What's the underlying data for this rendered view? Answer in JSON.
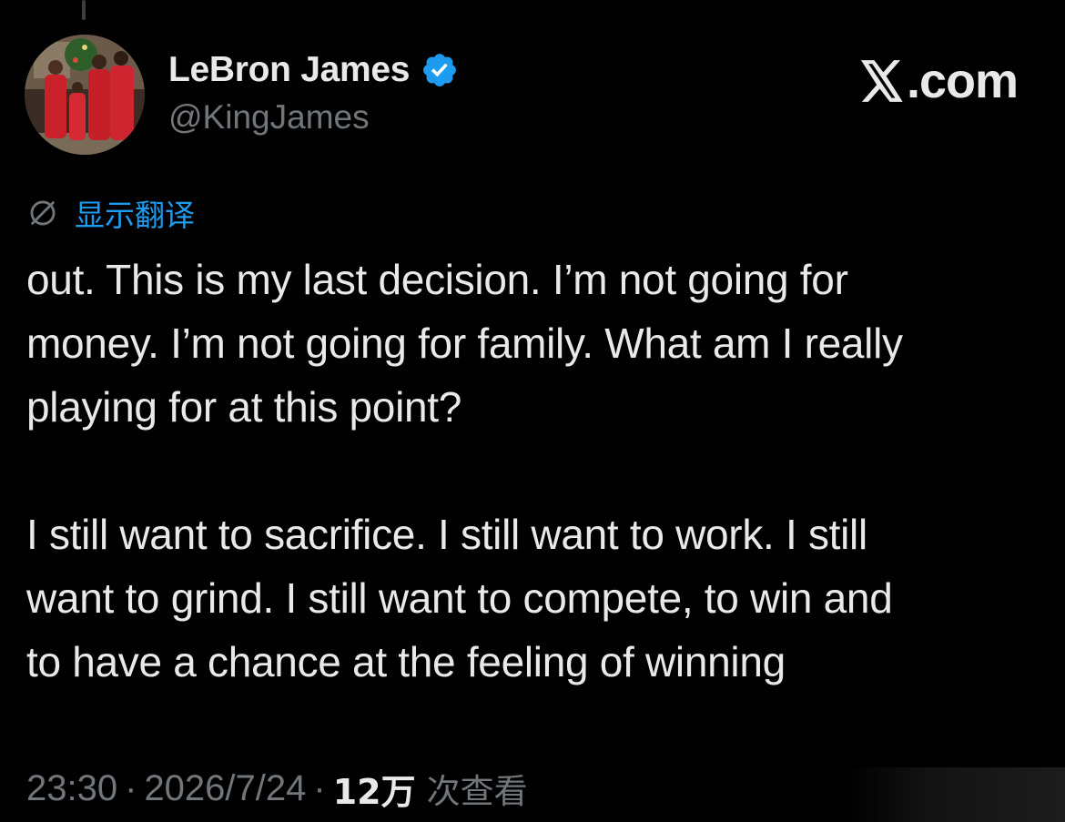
{
  "author": {
    "display_name": "LeBron James",
    "handle": "@KingJames",
    "verified": true,
    "avatar_icon": "avatar-photo"
  },
  "watermark": {
    "text": ".com",
    "logo_icon": "x-logo-icon"
  },
  "translate": {
    "label": "显示翻译",
    "icon": "globe-icon"
  },
  "tweet": {
    "paragraphs": [
      "out. This is my last decision. I’m not going for\nmoney. I’m not going for family. What am I really\nplaying for at this point?",
      "I still want to sacrifice. I still want to work. I still\nwant to grind. I still want to compete, to win and\nto have a chance at the feeling of winning"
    ]
  },
  "meta": {
    "time": "23:30",
    "separator": "·",
    "date": "2026/7/24",
    "views_count": "12万",
    "views_label": "次查看"
  },
  "colors": {
    "background": "#000000",
    "text": "#e7e9ea",
    "secondary": "#71767b",
    "accent": "#1d9bf0"
  }
}
